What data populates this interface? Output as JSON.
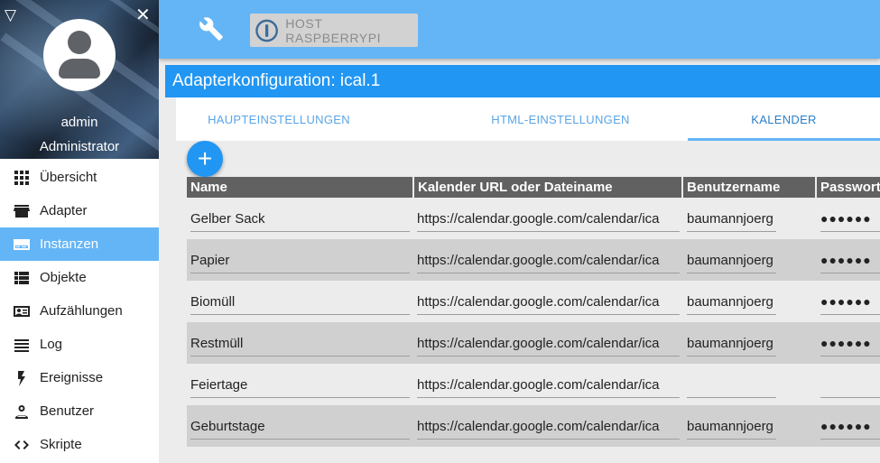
{
  "sidebar": {
    "user_name": "admin",
    "user_role": "Administrator",
    "items": [
      {
        "label": "Übersicht",
        "icon": "apps-grid-icon",
        "active": false
      },
      {
        "label": "Adapter",
        "icon": "store-icon",
        "active": false
      },
      {
        "label": "Instanzen",
        "icon": "instances-icon",
        "active": true
      },
      {
        "label": "Objekte",
        "icon": "list-view-icon",
        "active": false
      },
      {
        "label": "Aufzählungen",
        "icon": "contact-card-icon",
        "active": false
      },
      {
        "label": "Log",
        "icon": "lines-icon",
        "active": false
      },
      {
        "label": "Ereignisse",
        "icon": "flash-icon",
        "active": false
      },
      {
        "label": "Benutzer",
        "icon": "person-icon",
        "active": false
      },
      {
        "label": "Skripte",
        "icon": "code-icon",
        "active": false
      }
    ]
  },
  "topbar": {
    "host_label": "HOST RASPBERRYPI"
  },
  "config": {
    "title": "Adapterkonfiguration: ical.1",
    "tabs": [
      "HAUPTEINSTELLUNGEN",
      "HTML-EINSTELLUNGEN",
      "KALENDER"
    ],
    "active_tab": "KALENDER",
    "add_label": "+"
  },
  "table": {
    "headers": [
      "Name",
      "Kalender URL oder Dateiname",
      "Benutzername",
      "Passwort"
    ],
    "rows": [
      {
        "name": "Gelber Sack",
        "url": "https://calendar.google.com/calendar/ica",
        "user": "baumannjoerg",
        "password": "●●●●●●"
      },
      {
        "name": "Papier",
        "url": "https://calendar.google.com/calendar/ica",
        "user": "baumannjoerg",
        "password": "●●●●●●"
      },
      {
        "name": "Biomüll",
        "url": "https://calendar.google.com/calendar/ica",
        "user": "baumannjoerg",
        "password": "●●●●●●"
      },
      {
        "name": "Restmüll",
        "url": "https://calendar.google.com/calendar/ica",
        "user": "baumannjoerg",
        "password": "●●●●●●"
      },
      {
        "name": "Feiertage",
        "url": "https://calendar.google.com/calendar/ica",
        "user": "",
        "password": ""
      },
      {
        "name": "Geburtstage",
        "url": "https://calendar.google.com/calendar/ica",
        "user": "baumannjoerg",
        "password": "●●●●●●"
      }
    ]
  },
  "colors": {
    "primary": "#2196f3",
    "accent": "#64b5f6",
    "header_bg": "#616161",
    "row_shade": "#d0d0d0"
  }
}
